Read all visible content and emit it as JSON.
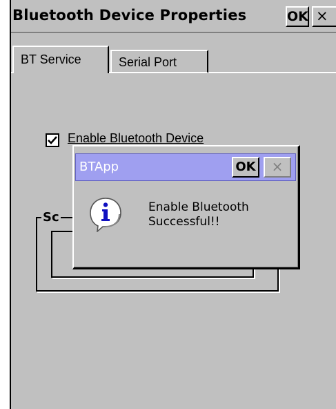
{
  "window": {
    "title": "Bluetooth Device Properties",
    "ok_label": "OK",
    "close_glyph": "×"
  },
  "tabs": [
    {
      "label": "BT Service",
      "selected": true
    },
    {
      "label": "Serial Port",
      "selected": false
    }
  ],
  "bt_service": {
    "enable_checkbox_label": "Enable Bluetooth Device",
    "enable_checked": true,
    "group_label_partial": "Sc"
  },
  "dialog": {
    "title": "BTApp",
    "ok_label": "OK",
    "close_glyph": "×",
    "icon": "info-icon",
    "message_line1": "Enable Bluetooth",
    "message_line2": "Successful!!"
  },
  "colors": {
    "window_bg": "#c0c0c0",
    "dialog_titlebar": "#9f9ff0",
    "dialog_title_text": "#ffffff",
    "info_icon_blue": "#1010c0"
  }
}
